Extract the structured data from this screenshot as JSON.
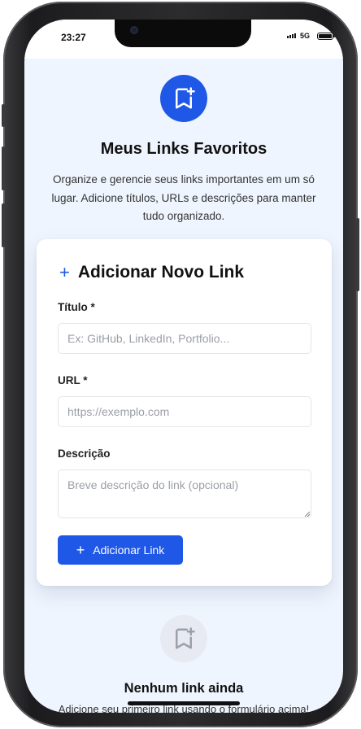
{
  "status_bar": {
    "time": "23:27",
    "network": "5G"
  },
  "hero": {
    "icon": "bookmark-plus-icon",
    "title": "Meus Links Favoritos",
    "subtitle": "Organize e gerencie seus links importantes em um só lugar. Adicione títulos, URLs e descrições para manter tudo organizado."
  },
  "form": {
    "title": "Adicionar Novo Link",
    "title_label": "Título *",
    "title_placeholder": "Ex: GitHub, LinkedIn, Portfolio...",
    "url_label": "URL *",
    "url_placeholder": "https://exemplo.com",
    "description_label": "Descrição",
    "description_placeholder": "Breve descrição do link (opcional)",
    "submit_label": "Adicionar Link"
  },
  "empty_state": {
    "icon": "bookmark-plus-icon",
    "title": "Nenhum link ainda",
    "subtitle": "Adicione seu primeiro link usando o formulário acima!"
  },
  "colors": {
    "accent": "#1f57e7",
    "page_background": "#eff5fe",
    "empty_icon_background": "#e7ebf1"
  }
}
